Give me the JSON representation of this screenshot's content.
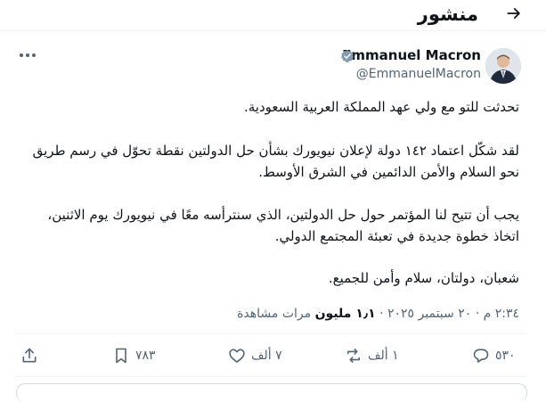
{
  "header": {
    "title": "منشور"
  },
  "author": {
    "name": "Emmanuel Macron",
    "handle": "@EmmanuelMacron"
  },
  "post": {
    "paragraphs": [
      "تحدثت للتو مع ولي عهد المملكة العربية السعودية.",
      "لقد شكّل اعتماد ١٤٢ دولة لإعلان نيويورك بشأن حل الدولتين نقطة تحوّل في رسم طريق نحو السلام والأمن الدائمين في الشرق الأوسط.",
      "يجب أن تتيح لنا المؤتمر حول حل الدولتين، الذي سنترأسه معًا في نيويورك يوم الاثنين، اتخاذ خطوة جديدة في تعبئة المجتمع الدولي.",
      "شعبان، دولتان، سلام وأمن للجميع."
    ]
  },
  "meta": {
    "time_date": "٢:٣٤ م · ٢٠ سبتمبر ٢٠٢٥ · ",
    "views_count": "١٫١ مليون",
    "views_label": " مرات مشاهدة"
  },
  "actions": {
    "replies": "٥٣٠",
    "reposts": "١ ألف",
    "likes": "٧ ألف",
    "bookmarks": "٧٨٣"
  },
  "colors": {
    "text": "#0f1419",
    "secondary": "#536471",
    "verified": "#829aab",
    "divider": "#eff3f4"
  },
  "icons": {
    "back": "arrow-right-icon",
    "verified": "verified-badge-icon",
    "more": "more-horizontal-icon",
    "reply": "comment-icon",
    "repost": "repost-icon",
    "like": "heart-icon",
    "bookmark": "bookmark-icon",
    "share": "share-icon"
  }
}
